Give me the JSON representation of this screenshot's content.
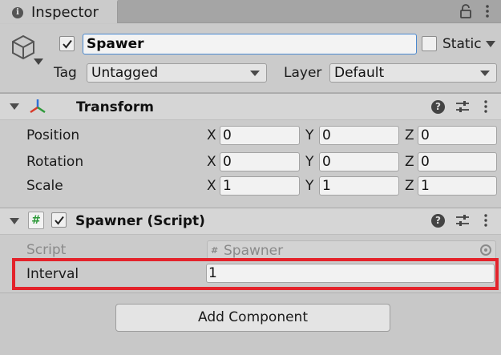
{
  "tab": {
    "title": "Inspector",
    "icon": "info-icon"
  },
  "header": {
    "active_checked": true,
    "object_name": "Spawer",
    "static_label": "Static",
    "static_checked": false,
    "tag_label": "Tag",
    "tag_value": "Untagged",
    "layer_label": "Layer",
    "layer_value": "Default"
  },
  "transform": {
    "title": "Transform",
    "rows": [
      {
        "label": "Position",
        "x": "0",
        "y": "0",
        "z": "0"
      },
      {
        "label": "Rotation",
        "x": "0",
        "y": "0",
        "z": "0"
      },
      {
        "label": "Scale",
        "x": "1",
        "y": "1",
        "z": "1"
      }
    ],
    "axes": {
      "x": "X",
      "y": "Y",
      "z": "Z"
    }
  },
  "spawner": {
    "title": "Spawner (Script)",
    "enabled": true,
    "script_label": "Script",
    "script_value": "Spawner",
    "interval_label": "Interval",
    "interval_value": "1"
  },
  "add_component_label": "Add Component",
  "colors": {
    "highlight": "#e3232b",
    "focus_border": "#4a88cf",
    "transform_icon_red": "#d83a2a",
    "transform_icon_green": "#2e9a3a",
    "transform_icon_blue": "#2f6fd6"
  }
}
